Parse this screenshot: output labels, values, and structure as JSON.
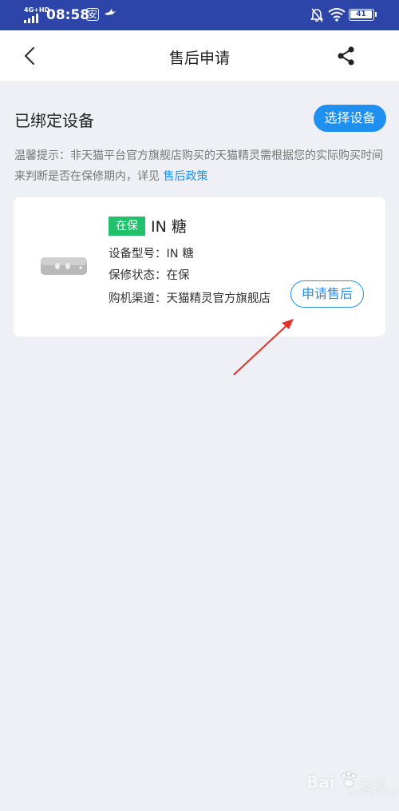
{
  "status_bar": {
    "network": "4G+HD",
    "time": "08:58",
    "app_badge": "安",
    "battery": "41"
  },
  "header": {
    "title": "售后申请"
  },
  "section": {
    "title": "已绑定设备",
    "select_button": "选择设备",
    "tip_text": "温馨提示：非天猫平台官方旗舰店购买的天猫精灵需根据您的实际购买时间来判断是否在保修期内，详见 ",
    "tip_link": "售后政策"
  },
  "device": {
    "badge": "在保",
    "name": "IN 糖",
    "model_label": "设备型号：",
    "model_value": "IN 糖",
    "warranty_label": "保修状态：",
    "warranty_value": "在保",
    "channel_label": "购机渠道：",
    "channel_value": "天猫精灵官方旗舰店",
    "apply_button": "申请售后"
  },
  "watermark": {
    "brand": "Bai",
    "sub": "jingyan.baidu.com",
    "suffix": "经验"
  },
  "colors": {
    "status_bar": "#2d45a8",
    "accent": "#1f8ff0",
    "badge_green": "#21c16b",
    "arrow_red": "#e0322a"
  }
}
